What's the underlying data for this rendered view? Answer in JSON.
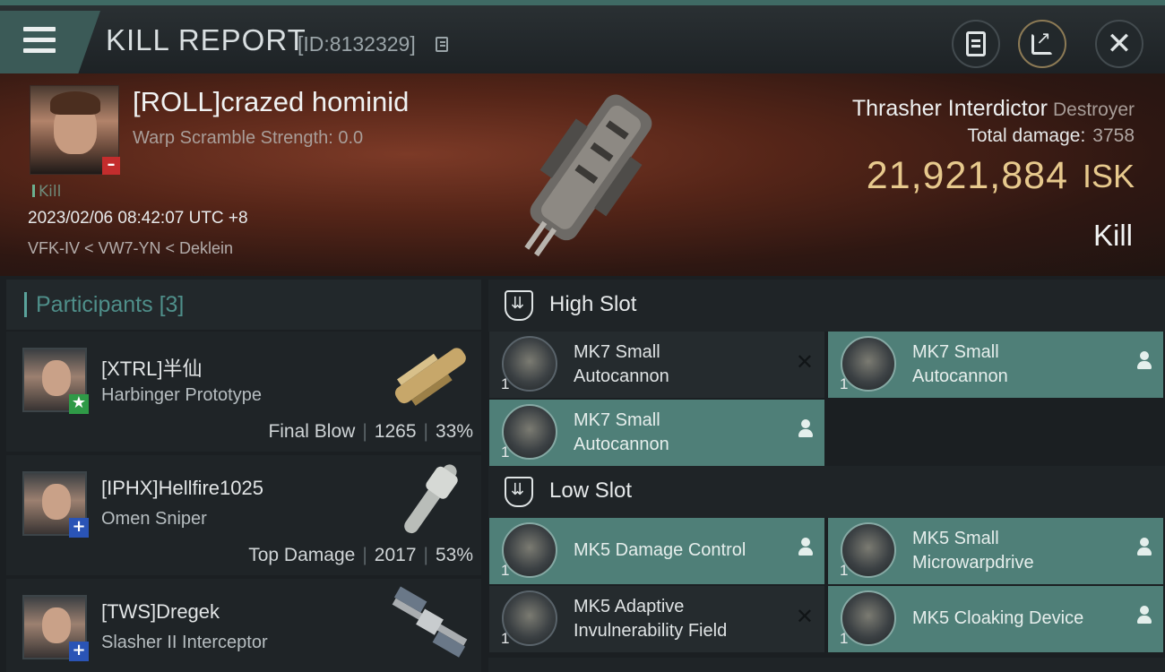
{
  "header": {
    "title": "KILL REPORT",
    "report_id": "[ID:8132329]"
  },
  "victim": {
    "name": "[ROLL]crazed hominid",
    "warp_scramble": "Warp Scramble Strength: 0.0",
    "kill_tag": "Kill",
    "datetime": "2023/02/06 08:42:07 UTC +8",
    "location": "VFK-IV < VW7-YN < Deklein",
    "ship_name": "Thrasher Interdictor",
    "ship_class": "Destroyer",
    "total_damage_label": "Total damage:",
    "total_damage": "3758",
    "isk_value": "21,921,884",
    "isk_unit": "ISK",
    "result": "Kill"
  },
  "participants": {
    "label": "Participants",
    "count": "[3]",
    "items": [
      {
        "name": "[XTRL]半仙",
        "ship": "Harbinger Prototype",
        "role": "Final Blow",
        "damage": "1265",
        "percent": "33%",
        "badge": "star"
      },
      {
        "name": "[IPHX]Hellfire1025",
        "ship": "Omen Sniper",
        "role": "Top Damage",
        "damage": "2017",
        "percent": "53%",
        "badge": "plus"
      },
      {
        "name": "[TWS]Dregek",
        "ship": "Slasher II Interceptor",
        "badge": "plus"
      }
    ]
  },
  "slots": {
    "high": {
      "title": "High Slot",
      "modules": [
        {
          "line1": "MK7 Small",
          "line2": "Autocannon",
          "qty": "1",
          "status": "destroyed"
        },
        {
          "line1": "MK7 Small",
          "line2": "Autocannon",
          "qty": "1",
          "status": "dropped"
        },
        {
          "line1": "MK7 Small",
          "line2": "Autocannon",
          "qty": "1",
          "status": "dropped"
        }
      ]
    },
    "low": {
      "title": "Low Slot",
      "modules": [
        {
          "line1": "MK5 Damage Control",
          "line2": "",
          "qty": "1",
          "status": "dropped"
        },
        {
          "line1": "MK5 Small",
          "line2": "Microwarpdrive",
          "qty": "1",
          "status": "dropped"
        },
        {
          "line1": "MK5 Adaptive",
          "line2": "Invulnerability Field",
          "qty": "1",
          "status": "destroyed"
        },
        {
          "line1": "MK5 Cloaking Device",
          "line2": "",
          "qty": "1",
          "status": "dropped"
        }
      ]
    }
  },
  "icons": {
    "menu": "hamburger-icon",
    "copy": "copy-icon",
    "clipboard": "clipboard-icon",
    "share": "share-icon",
    "close": "close-icon",
    "destroyed": "x-mark-icon",
    "dropped": "pilot-icon"
  },
  "colors": {
    "accent": "#4f7f78",
    "isk": "#e7c98d",
    "victim_badge": "#c32d2d",
    "final_blow_badge": "#2f9a47",
    "participant_badge": "#2a54b6"
  }
}
